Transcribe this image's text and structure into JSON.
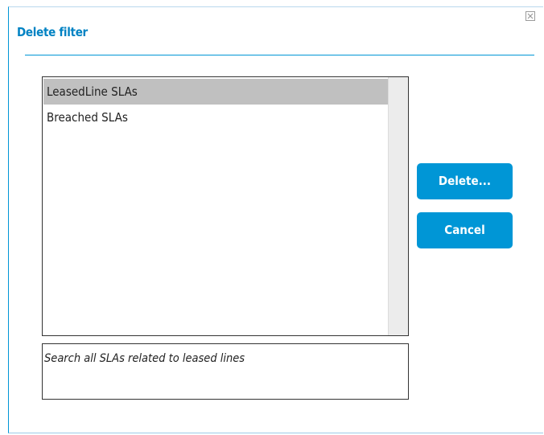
{
  "dialog": {
    "title": "Delete filter",
    "close_icon": "close-icon"
  },
  "filters": {
    "items": [
      {
        "label": "LeasedLine SLAs",
        "selected": true
      },
      {
        "label": "Breached SLAs",
        "selected": false
      }
    ]
  },
  "description": {
    "text": "Search all SLAs related to leased lines"
  },
  "buttons": {
    "delete_label": "Delete...",
    "cancel_label": "Cancel"
  },
  "colors": {
    "accent": "#0096d6",
    "title": "#0082c3",
    "selection": "#c0c0c0"
  }
}
